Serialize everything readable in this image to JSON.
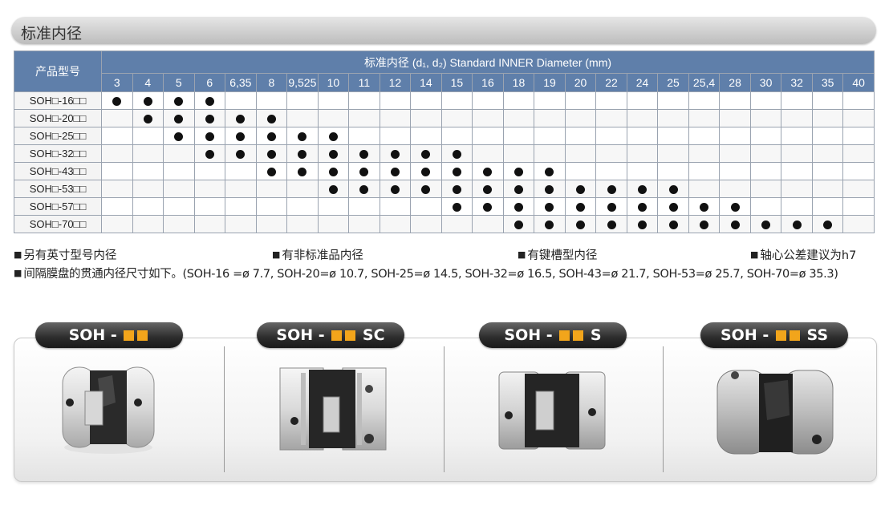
{
  "page_title": "标准内径",
  "table": {
    "model_header": "产品型号",
    "diameter_header": "标准内径 (d₁, d₂) Standard INNER Diameter (mm)",
    "sizes": [
      "3",
      "4",
      "5",
      "6",
      "6.35",
      "8",
      "9.525",
      "10",
      "11",
      "12",
      "14",
      "15",
      "16",
      "18",
      "19",
      "20",
      "22",
      "24",
      "25",
      "25.4",
      "28",
      "30",
      "32",
      "35",
      "40"
    ],
    "rows": [
      {
        "model": "SOH□-16□□",
        "available": [
          "3",
          "4",
          "5",
          "6"
        ]
      },
      {
        "model": "SOH□-20□□",
        "available": [
          "4",
          "5",
          "6",
          "6.35",
          "8"
        ]
      },
      {
        "model": "SOH□-25□□",
        "available": [
          "5",
          "6",
          "6.35",
          "8",
          "9.525",
          "10"
        ]
      },
      {
        "model": "SOH□-32□□",
        "available": [
          "6",
          "6.35",
          "8",
          "9.525",
          "10",
          "11",
          "12",
          "14",
          "15"
        ]
      },
      {
        "model": "SOH□-43□□",
        "available": [
          "8",
          "9.525",
          "10",
          "11",
          "12",
          "14",
          "15",
          "16",
          "18",
          "19"
        ]
      },
      {
        "model": "SOH□-53□□",
        "available": [
          "10",
          "11",
          "12",
          "14",
          "15",
          "16",
          "18",
          "19",
          "20",
          "22",
          "24",
          "25"
        ]
      },
      {
        "model": "SOH□-57□□",
        "available": [
          "15",
          "16",
          "18",
          "19",
          "20",
          "22",
          "24",
          "25",
          "25.4",
          "28"
        ]
      },
      {
        "model": "SOH□-70□□",
        "available": [
          "18",
          "19",
          "20",
          "22",
          "24",
          "25",
          "25.4",
          "28",
          "30",
          "32",
          "35"
        ]
      }
    ]
  },
  "notes": {
    "n1": "另有英寸型号内径",
    "n2": "有非标准品内径",
    "n3": "有键槽型内径",
    "n4": "轴心公差建议为h7",
    "n5": "间隔膜盘的贯通内径尺寸如下。(SOH-16 =ø 7.7, SOH-20=ø 10.7, SOH-25=ø 14.5, SOH-32=ø 16.5, SOH-43=ø 21.7, SOH-53=ø 25.7, SOH-70=ø 35.3)",
    "bullet": "■"
  },
  "products": [
    {
      "prefix": "SOH -",
      "suffix": ""
    },
    {
      "prefix": "SOH -",
      "suffix": "SC"
    },
    {
      "prefix": "SOH -",
      "suffix": "S"
    },
    {
      "prefix": "SOH -",
      "suffix": "SS"
    }
  ],
  "colors": {
    "header_blue": "#5f7faa",
    "badge_square": "#f2a51b",
    "dot": "#111111"
  }
}
